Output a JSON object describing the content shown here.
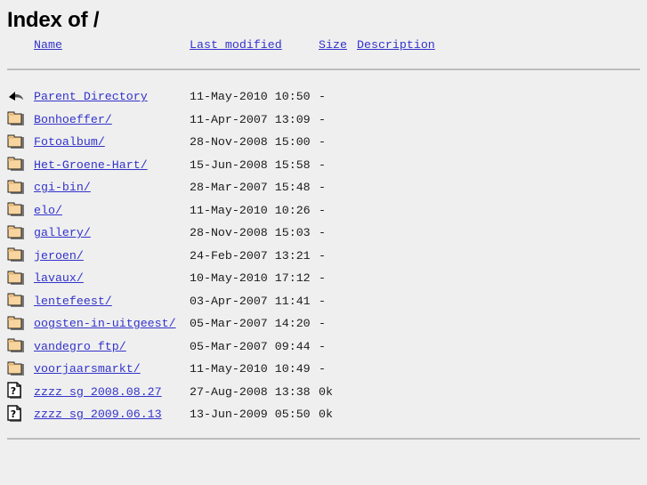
{
  "page": {
    "title": "Index of /",
    "background_color": "#efefef",
    "link_color": "#3333cc",
    "rule_color": "#bcbcbc"
  },
  "table": {
    "headers": {
      "icon": "",
      "name": "Name",
      "last_modified": "Last modified",
      "size": "Size",
      "description": "Description"
    },
    "rows": [
      {
        "icon": "back-icon",
        "name": "Parent Directory",
        "last_modified": "11-May-2010 10:50",
        "size": "-",
        "description": ""
      },
      {
        "icon": "folder-icon",
        "name": "Bonhoeffer/",
        "last_modified": "11-Apr-2007 13:09",
        "size": "-",
        "description": ""
      },
      {
        "icon": "folder-icon",
        "name": "Fotoalbum/",
        "last_modified": "28-Nov-2008 15:00",
        "size": "-",
        "description": ""
      },
      {
        "icon": "folder-icon",
        "name": "Het-Groene-Hart/",
        "last_modified": "15-Jun-2008 15:58",
        "size": "-",
        "description": ""
      },
      {
        "icon": "folder-icon",
        "name": "cgi-bin/",
        "last_modified": "28-Mar-2007 15:48",
        "size": "-",
        "description": ""
      },
      {
        "icon": "folder-icon",
        "name": "elo/",
        "last_modified": "11-May-2010 10:26",
        "size": "-",
        "description": ""
      },
      {
        "icon": "folder-icon",
        "name": "gallery/",
        "last_modified": "28-Nov-2008 15:03",
        "size": "-",
        "description": ""
      },
      {
        "icon": "folder-icon",
        "name": "jeroen/",
        "last_modified": "24-Feb-2007 13:21",
        "size": "-",
        "description": ""
      },
      {
        "icon": "folder-icon",
        "name": "lavaux/",
        "last_modified": "10-May-2010 17:12",
        "size": "-",
        "description": ""
      },
      {
        "icon": "folder-icon",
        "name": "lentefeest/",
        "last_modified": "03-Apr-2007 11:41",
        "size": "-",
        "description": ""
      },
      {
        "icon": "folder-icon",
        "name": "oogsten-in-uitgeest/",
        "last_modified": "05-Mar-2007 14:20",
        "size": "-",
        "description": ""
      },
      {
        "icon": "folder-icon",
        "name": "vandegro ftp/",
        "last_modified": "05-Mar-2007 09:44",
        "size": "-",
        "description": ""
      },
      {
        "icon": "folder-icon",
        "name": "voorjaarsmarkt/",
        "last_modified": "11-May-2010 10:49",
        "size": "-",
        "description": ""
      },
      {
        "icon": "unknown-file-icon",
        "name": "zzzz sg 2008.08.27",
        "last_modified": "27-Aug-2008 13:38",
        "size": "0k",
        "description": ""
      },
      {
        "icon": "unknown-file-icon",
        "name": "zzzz sg 2009.06.13",
        "last_modified": "13-Jun-2009 05:50",
        "size": "0k",
        "description": ""
      }
    ]
  }
}
